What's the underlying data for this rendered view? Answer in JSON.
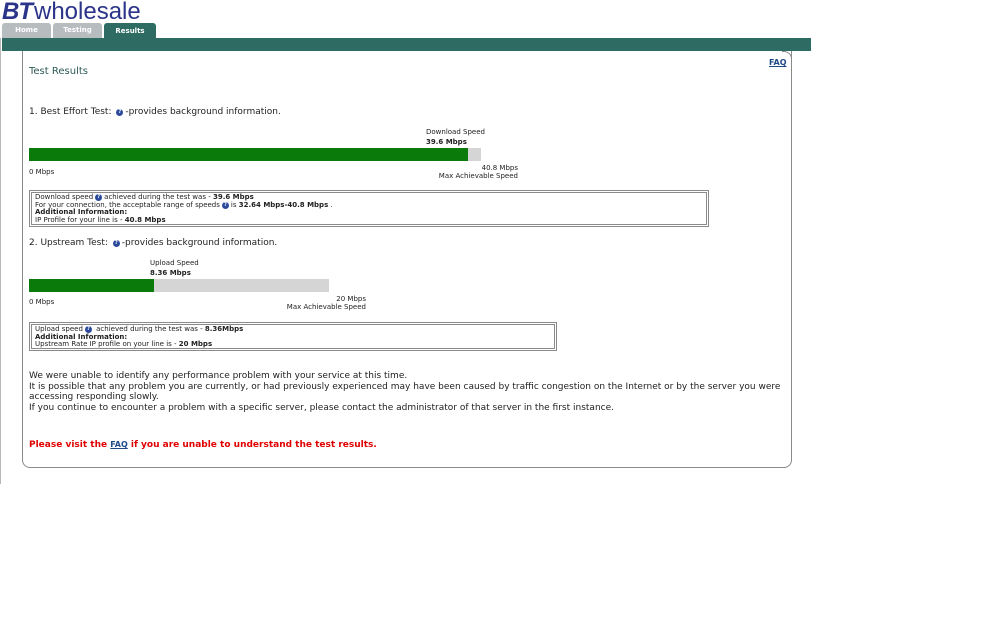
{
  "logo": {
    "bt": "BT",
    "wholesale": "wholesale"
  },
  "tabs": [
    {
      "label": "Home",
      "active": false
    },
    {
      "label": "Testing",
      "active": false
    },
    {
      "label": "Results",
      "active": true
    }
  ],
  "faq_link": "FAQ",
  "page_title": "Test Results",
  "best_effort": {
    "heading": "1. Best Effort Test:",
    "heading_suffix": "-provides background information.",
    "bar_label": "Download Speed",
    "bar_value": "39.6 Mbps",
    "measured_mbps": 39.6,
    "max_mbps": 40.8,
    "axis_min": "0 Mbps",
    "axis_max": "40.8 Mbps",
    "axis_max_caption": "Max Achievable Speed",
    "box": {
      "line1_pre": "Download speed",
      "line1_mid": "achieved during the test was - ",
      "line1_val": "39.6 Mbps",
      "line2_pre": "For your connection, the acceptable range of speeds",
      "line2_mid": "is ",
      "line2_val": "32.64 Mbps-40.8 Mbps",
      "line2_end": " .",
      "line3": "Additional Information:",
      "line4_pre": "IP Profile for your line is - ",
      "line4_val": "40.8 Mbps"
    }
  },
  "upstream": {
    "heading": "2. Upstream Test:",
    "heading_suffix": "-provides background information.",
    "bar_label": "Upload Speed",
    "bar_value": "8.36 Mbps",
    "measured_mbps": 8.36,
    "max_mbps": 20,
    "axis_min": "0 Mbps",
    "axis_max": "20 Mbps",
    "axis_max_caption": "Max Achievable Speed",
    "box": {
      "line1_pre": "Upload speed",
      "line1_mid": " achieved during the test was - ",
      "line1_val": "8.36Mbps",
      "line2": "Additional Information:",
      "line3_pre": "Upstream Rate IP profile on your line is - ",
      "line3_val": "20 Mbps"
    }
  },
  "messages": {
    "line1": "We were unable to identify any performance problem with your service at this time.",
    "line2": "It is possible that any problem you are currently, or had previously experienced may have been caused by traffic congestion on the Internet or by the server you were",
    "line3": "accessing responding slowly.",
    "line4": "If you continue to encounter a problem with a specific server, please contact the administrator of that server in the first instance."
  },
  "visit": {
    "pre": "Please visit the ",
    "link": "FAQ",
    "post": " if you are unable to understand the test results."
  },
  "colors": {
    "brand": "#2b3489",
    "bar": "#2d6b63",
    "fill": "#0a7a0a",
    "track": "#d5d5d5",
    "alert": "#e00000"
  }
}
